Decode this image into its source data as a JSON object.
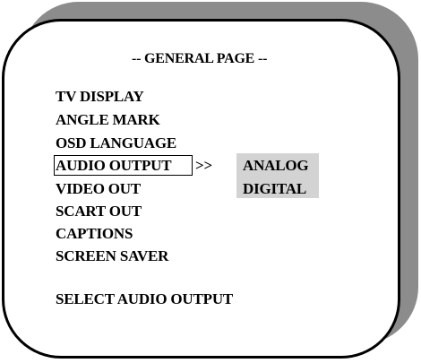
{
  "page": {
    "title": "-- GENERAL PAGE --"
  },
  "menu": {
    "items": [
      {
        "label": "TV DISPLAY"
      },
      {
        "label": "ANGLE MARK"
      },
      {
        "label": "OSD LANGUAGE"
      },
      {
        "label": "AUDIO OUTPUT",
        "selected": true
      },
      {
        "label": "VIDEO OUT"
      },
      {
        "label": "SCART OUT"
      },
      {
        "label": "CAPTIONS"
      },
      {
        "label": "SCREEN SAVER"
      }
    ],
    "submenu_arrow": ">>"
  },
  "submenu": {
    "options": [
      {
        "label": "ANALOG"
      },
      {
        "label": "DIGITAL"
      }
    ]
  },
  "help": {
    "text": "SELECT AUDIO OUTPUT"
  },
  "colors": {
    "panel_shadow": "#8c8c8c",
    "panel_background": "#ffffff",
    "panel_border": "#000000",
    "submenu_highlight": "#d3d3d3",
    "text": "#000000"
  }
}
